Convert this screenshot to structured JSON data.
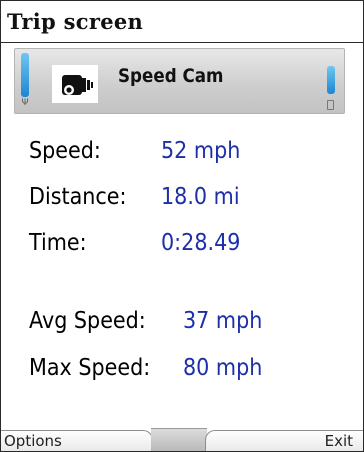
{
  "window": {
    "title": "Trip screen"
  },
  "status": {
    "app_name": "Speed Cam",
    "app_icon": "speed-camera-icon",
    "signal_icon": "signal-strength-icon",
    "battery_icon": "battery-level-icon"
  },
  "stats": [
    {
      "label": "Speed:",
      "value": "52 mph"
    },
    {
      "label": "Distance:",
      "value": "18.0 mi"
    },
    {
      "label": "Time:",
      "value": "0:28.49"
    },
    {
      "label": "Avg Speed:",
      "value": "37 mph"
    },
    {
      "label": "Max Speed:",
      "value": "80 mph"
    }
  ],
  "softkeys": {
    "left": "Options",
    "right": "Exit"
  },
  "colors": {
    "value_text": "#1c2fa8",
    "indicator_blue": "#1c86d3",
    "status_gray": "#cfcfcf"
  }
}
